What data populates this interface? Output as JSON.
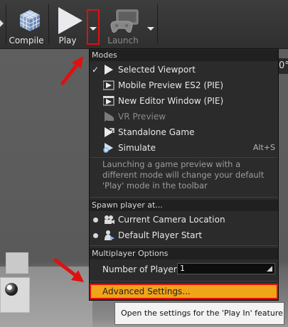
{
  "toolbar": {
    "compile_label": "Compile",
    "play_label": "Play",
    "launch_label": "Launch"
  },
  "viewport": {
    "corner_text": "0°"
  },
  "menu": {
    "modes_header": "Modes",
    "modes": [
      {
        "label": "Selected Viewport",
        "checked": true,
        "icon": "play-icon"
      },
      {
        "label": "Mobile Preview ES2 (PIE)",
        "icon": "mobile-preview-icon"
      },
      {
        "label": "New Editor Window (PIE)",
        "icon": "new-window-icon"
      },
      {
        "label": "VR Preview",
        "disabled": true,
        "icon": "vr-preview-icon"
      },
      {
        "label": "Standalone Game",
        "icon": "standalone-game-icon"
      },
      {
        "label": "Simulate",
        "shortcut": "Alt+S",
        "icon": "simulate-icon"
      }
    ],
    "modes_description": "Launching a game preview with a different mode will change your default 'Play' mode in the toolbar",
    "spawn_header": "Spawn player at...",
    "spawn": [
      {
        "label": "Current Camera Location",
        "icon": "camera-icon"
      },
      {
        "label": "Default Player Start",
        "icon": "player-start-icon"
      }
    ],
    "multiplayer_header": "Multiplayer Options",
    "players_label": "Number of Players",
    "players_value": "1",
    "advanced_label": "Advanced Settings..."
  },
  "tooltip": {
    "text": "Open the settings for the 'Play In' feature"
  },
  "colors": {
    "highlight": "#f0a417",
    "annotation": "#e01010"
  }
}
